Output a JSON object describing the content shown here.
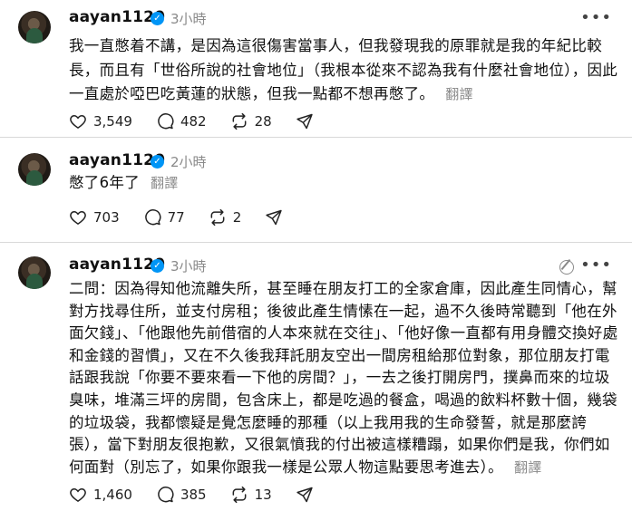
{
  "posts": [
    {
      "username": "aayan1120",
      "time": "3小時",
      "text": "我一直憋着不講，是因為這很傷害當事人，但我發現我的原罪就是我的年紀比較長，而且有「世俗所說的社會地位」（我根本從來不認為我有什麼社會地位），因此一直處於啞巴吃黃蓮的狀態，但我一點都不想再憋了。",
      "translate": "翻譯",
      "likes": "3,549",
      "comments": "482",
      "reposts": "28"
    },
    {
      "username": "aayan1120",
      "time": "2小時",
      "text": "憋了6年了",
      "translate": "翻譯",
      "likes": "703",
      "comments": "77",
      "reposts": "2"
    },
    {
      "username": "aayan1120",
      "time": "3小時",
      "text": "二問：因為得知他流離失所，甚至睡在朋友打工的全家倉庫，因此產生同情心，幫對方找尋住所，並支付房租；後彼此產生情愫在一起，過不久後時常聽到「他在外面欠錢」、「他跟他先前借宿的人本來就在交往」、「他好像一直都有用身體交換好處和金錢的習慣」，又在不久後我拜託朋友空出一間房租給那位對象，那位朋友打電話跟我說「你要不要來看一下他的房間？」，一去之後打開房門，撲鼻而來的垃圾臭味，堆滿三坪的房間，包含床上，都是吃過的餐盒，喝過的飲料杯數十個，幾袋的垃圾袋，我都懷疑是覺怎麼睡的那種（以上我用我的生命發誓，就是那麼誇張），當下對朋友很抱歉，又很氣憤我的付出被這樣糟蹋，如果你們是我，你們如何面對（別忘了，如果你跟我一樣是公眾人物這點要思考進去）。",
      "translate": "翻譯",
      "likes": "1,460",
      "comments": "385",
      "reposts": "13"
    }
  ],
  "icons": {
    "verified": "verified-badge-icon",
    "like": "heart-icon",
    "comment": "comment-bubble-icon",
    "repost": "repost-icon",
    "share": "send-icon",
    "more": "more-options-icon",
    "edited": "edited-indicator-icon"
  },
  "colors": {
    "verified": "#0095f6",
    "muted_text": "#8a8a8a"
  }
}
